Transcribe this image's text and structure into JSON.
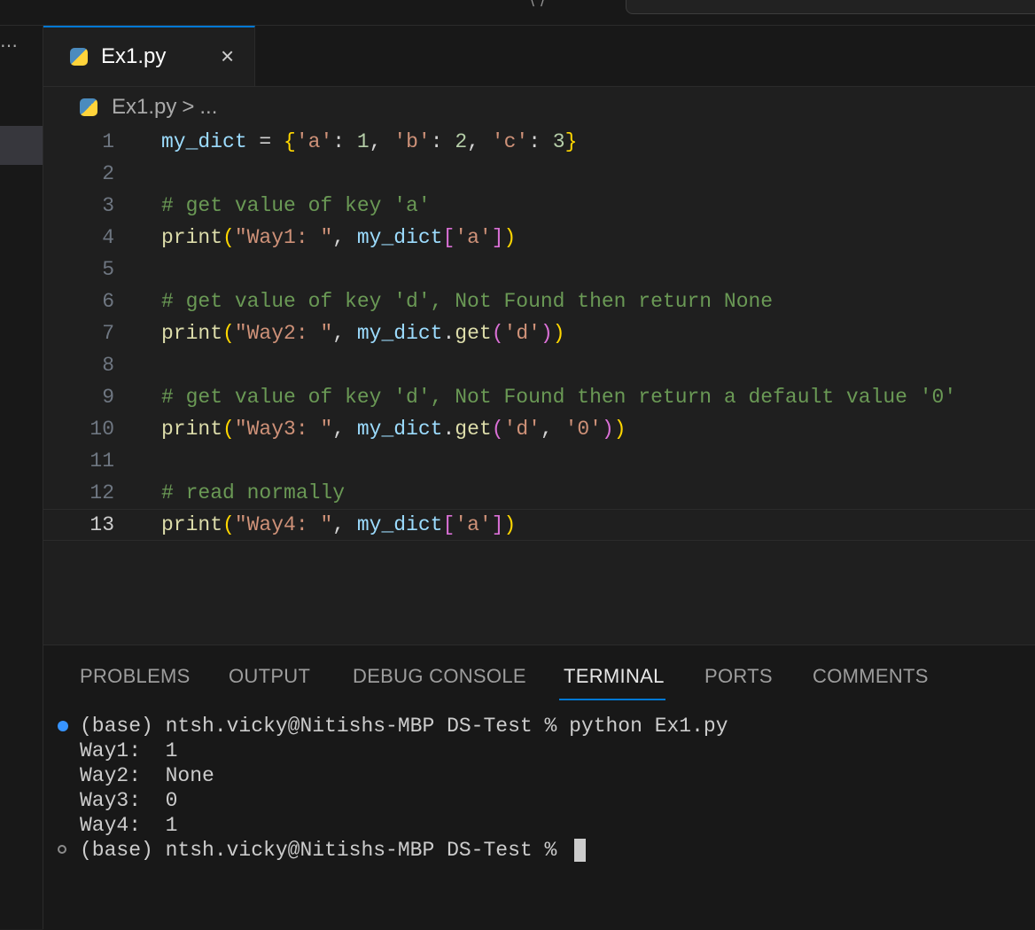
{
  "tab": {
    "title": "Ex1.py",
    "close_glyph": "×"
  },
  "breadcrumb": {
    "file": "Ex1.py",
    "separator": ">",
    "more": "..."
  },
  "editor": {
    "lines": [
      {
        "n": "1",
        "tokens": [
          [
            "var",
            "my_dict"
          ],
          [
            "op",
            " = "
          ],
          [
            "p1",
            "{"
          ],
          [
            "str",
            "'a'"
          ],
          [
            "op",
            ": "
          ],
          [
            "num",
            "1"
          ],
          [
            "op",
            ", "
          ],
          [
            "str",
            "'b'"
          ],
          [
            "op",
            ": "
          ],
          [
            "num",
            "2"
          ],
          [
            "op",
            ", "
          ],
          [
            "str",
            "'c'"
          ],
          [
            "op",
            ": "
          ],
          [
            "num",
            "3"
          ],
          [
            "p1",
            "}"
          ]
        ]
      },
      {
        "n": "2",
        "tokens": []
      },
      {
        "n": "3",
        "tokens": [
          [
            "cmt",
            "# get value of key 'a'"
          ]
        ]
      },
      {
        "n": "4",
        "tokens": [
          [
            "fn",
            "print"
          ],
          [
            "p1",
            "("
          ],
          [
            "str",
            "\"Way1: \""
          ],
          [
            "op",
            ", "
          ],
          [
            "var",
            "my_dict"
          ],
          [
            "p2",
            "["
          ],
          [
            "str",
            "'a'"
          ],
          [
            "p2",
            "]"
          ],
          [
            "p1",
            ")"
          ]
        ]
      },
      {
        "n": "5",
        "tokens": []
      },
      {
        "n": "6",
        "tokens": [
          [
            "cmt",
            "# get value of key 'd', Not Found then return None"
          ]
        ]
      },
      {
        "n": "7",
        "tokens": [
          [
            "fn",
            "print"
          ],
          [
            "p1",
            "("
          ],
          [
            "str",
            "\"Way2: \""
          ],
          [
            "op",
            ", "
          ],
          [
            "var",
            "my_dict"
          ],
          [
            "op",
            "."
          ],
          [
            "fn",
            "get"
          ],
          [
            "p2",
            "("
          ],
          [
            "str",
            "'d'"
          ],
          [
            "p2",
            ")"
          ],
          [
            "p1",
            ")"
          ]
        ]
      },
      {
        "n": "8",
        "tokens": []
      },
      {
        "n": "9",
        "tokens": [
          [
            "cmt",
            "# get value of key 'd', Not Found then return a default value '0'"
          ]
        ]
      },
      {
        "n": "10",
        "tokens": [
          [
            "fn",
            "print"
          ],
          [
            "p1",
            "("
          ],
          [
            "str",
            "\"Way3: \""
          ],
          [
            "op",
            ", "
          ],
          [
            "var",
            "my_dict"
          ],
          [
            "op",
            "."
          ],
          [
            "fn",
            "get"
          ],
          [
            "p2",
            "("
          ],
          [
            "str",
            "'d'"
          ],
          [
            "op",
            ", "
          ],
          [
            "str",
            "'0'"
          ],
          [
            "p2",
            ")"
          ],
          [
            "p1",
            ")"
          ]
        ]
      },
      {
        "n": "11",
        "tokens": []
      },
      {
        "n": "12",
        "tokens": [
          [
            "cmt",
            "# read normally"
          ]
        ]
      },
      {
        "n": "13",
        "tokens": [
          [
            "fn",
            "print"
          ],
          [
            "p1",
            "("
          ],
          [
            "str",
            "\"Way4: \""
          ],
          [
            "op",
            ", "
          ],
          [
            "var",
            "my_dict"
          ],
          [
            "p2",
            "["
          ],
          [
            "str",
            "'a'"
          ],
          [
            "p2",
            "]"
          ],
          [
            "p1",
            ")"
          ]
        ]
      }
    ]
  },
  "panel": {
    "tabs": [
      "PROBLEMS",
      "OUTPUT",
      "DEBUG CONSOLE",
      "TERMINAL",
      "PORTS",
      "COMMENTS"
    ],
    "active_tab": "TERMINAL"
  },
  "terminal": {
    "lines": [
      "(base) ntsh.vicky@Nitishs-MBP DS-Test % python Ex1.py",
      "Way1:  1",
      "Way2:  None",
      "Way3:  0",
      "Way4:  1",
      "(base) ntsh.vicky@Nitishs-MBP DS-Test % "
    ]
  },
  "colors": {
    "accent": "#0078d4",
    "editor_bg": "#1f1f1f",
    "panel_bg": "#181818",
    "success_dot": "#3794ff"
  }
}
